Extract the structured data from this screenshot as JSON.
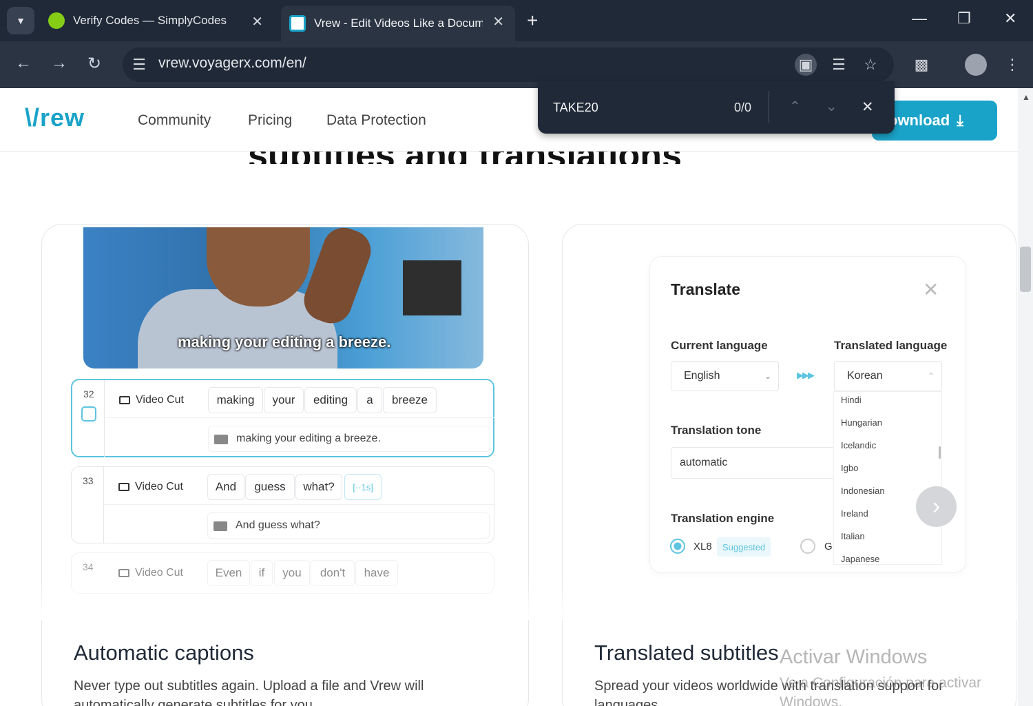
{
  "browser": {
    "tabs": [
      {
        "title": "Verify Codes — SimplyCodes",
        "icon": "simplycodes-icon",
        "color": "#84cc16"
      },
      {
        "title": "Vrew - Edit Videos Like a Docum",
        "icon": "vrew-icon",
        "color": "#1aa3c9"
      }
    ],
    "new_tab": "+",
    "url": "vrew.voyagerx.com/en/"
  },
  "find_bar": {
    "query": "TAKE20",
    "count": "0/0"
  },
  "site": {
    "logo": "\\/rew",
    "menu": [
      "Community",
      "Pricing",
      "Data Protection"
    ],
    "download_label": "ownload",
    "headline": "subtitles and translations"
  },
  "captions_card": {
    "video_caption": "making your editing a breeze.",
    "rows": [
      {
        "num": "32",
        "mode": "Video Cut",
        "words": [
          "making",
          "your",
          "editing",
          "a",
          "breeze"
        ],
        "subtitle": "making your editing a breeze."
      },
      {
        "num": "33",
        "mode": "Video Cut",
        "words": [
          "And",
          "guess",
          "what?",
          "[··1s]"
        ],
        "subtitle": "And guess what?"
      },
      {
        "num": "34",
        "mode": "Video Cut",
        "words": [
          "Even",
          "if",
          "you",
          "don't",
          "have"
        ]
      }
    ],
    "title": "Automatic captions",
    "desc_line1": "Never type out subtitles again. Upload a file and Vrew will",
    "desc_line2": "automatically generate subtitles for you."
  },
  "translate_card": {
    "panel_title": "Translate",
    "current_language_label": "Current language",
    "current_language": "English",
    "translated_language_label": "Translated language",
    "translated_language": "Korean",
    "tone_label": "Translation tone",
    "tone": "automatic",
    "engine_label": "Translation engine",
    "engine_option1": "XL8",
    "suggested": "Suggested",
    "engine_option2": "G",
    "languages": [
      "Hindi",
      "Hungarian",
      "Icelandic",
      "Igbo",
      "Indonesian",
      "Ireland",
      "Italian",
      "Japanese"
    ],
    "title": "Translated subtitles",
    "desc_line1": "Spread your videos worldwide with translation support for",
    "desc_line2": "languages."
  },
  "watermark": {
    "line1": "Activar Windows",
    "line2": "Ve a Configuración para activar Windows."
  }
}
